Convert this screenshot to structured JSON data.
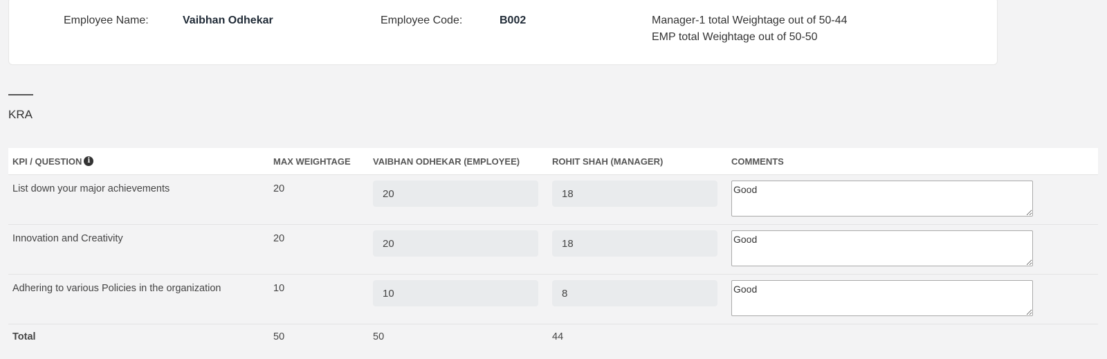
{
  "employee": {
    "name_label": "Employee Name:",
    "name_value": "Vaibhan Odhekar",
    "code_label": "Employee Code:",
    "code_value": "B002",
    "manager_weightage": "Manager-1 total Weightage out of 50-44",
    "emp_weightage": "EMP total Weightage out of 50-50"
  },
  "section": {
    "title": "KRA"
  },
  "table": {
    "headers": {
      "kpi": "KPI / QUESTION",
      "max": "MAX WEIGHTAGE",
      "employee": "VAIBHAN ODHEKAR (EMPLOYEE)",
      "manager": "ROHIT SHAH (MANAGER)",
      "comments": "COMMENTS"
    },
    "info_icon": "info-icon",
    "rows": [
      {
        "question": "List down your major achievements",
        "max": "20",
        "employee": "20",
        "manager": "18",
        "comment": "Good"
      },
      {
        "question": "Innovation and Creativity",
        "max": "20",
        "employee": "20",
        "manager": "18",
        "comment": "Good"
      },
      {
        "question": "Adhering to various Policies in the organization",
        "max": "10",
        "employee": "10",
        "manager": "8",
        "comment": "Good"
      }
    ],
    "total": {
      "label": "Total",
      "max": "50",
      "employee": "50",
      "manager": "44"
    }
  }
}
